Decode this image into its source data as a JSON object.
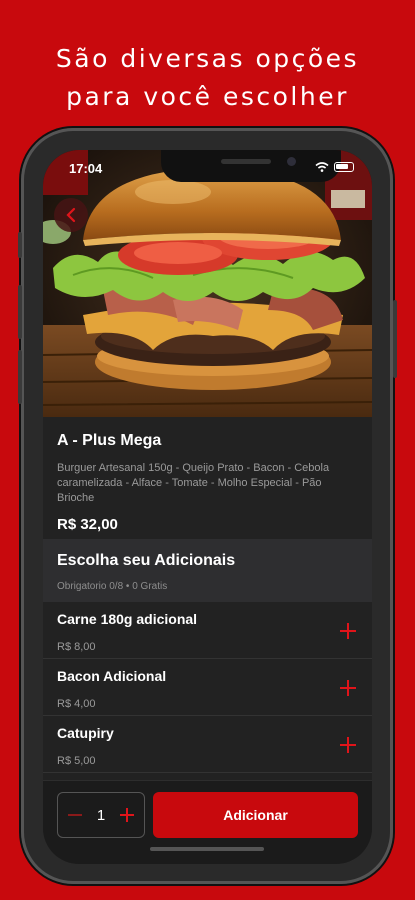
{
  "headline": {
    "line1": "São diversas opções",
    "line2": "para você escolher"
  },
  "status_bar": {
    "time": "17:04",
    "icons": [
      "wifi-icon",
      "battery-icon"
    ]
  },
  "product": {
    "name": "A - Plus Mega",
    "description": "Burguer Artesanal 150g - Queijo Prato - Bacon - Cebola caramelizada - Alface - Tomate - Molho Especial - Pão Brioche",
    "price": "R$ 32,00"
  },
  "addons": {
    "title": "Escolha seu Adicionais",
    "subtitle": "Obrigatorio 0/8 • 0 Gratis",
    "items": [
      {
        "name": "Carne 180g adicional",
        "price": "R$ 8,00"
      },
      {
        "name": "Bacon Adicional",
        "price": "R$ 4,00"
      },
      {
        "name": "Catupiry",
        "price": "R$ 5,00"
      }
    ]
  },
  "cart": {
    "quantity": "1",
    "add_label": "Adicionar"
  },
  "colors": {
    "brand_red": "#c8090d",
    "surface": "#222222",
    "accent_plus": "#e0141a"
  }
}
